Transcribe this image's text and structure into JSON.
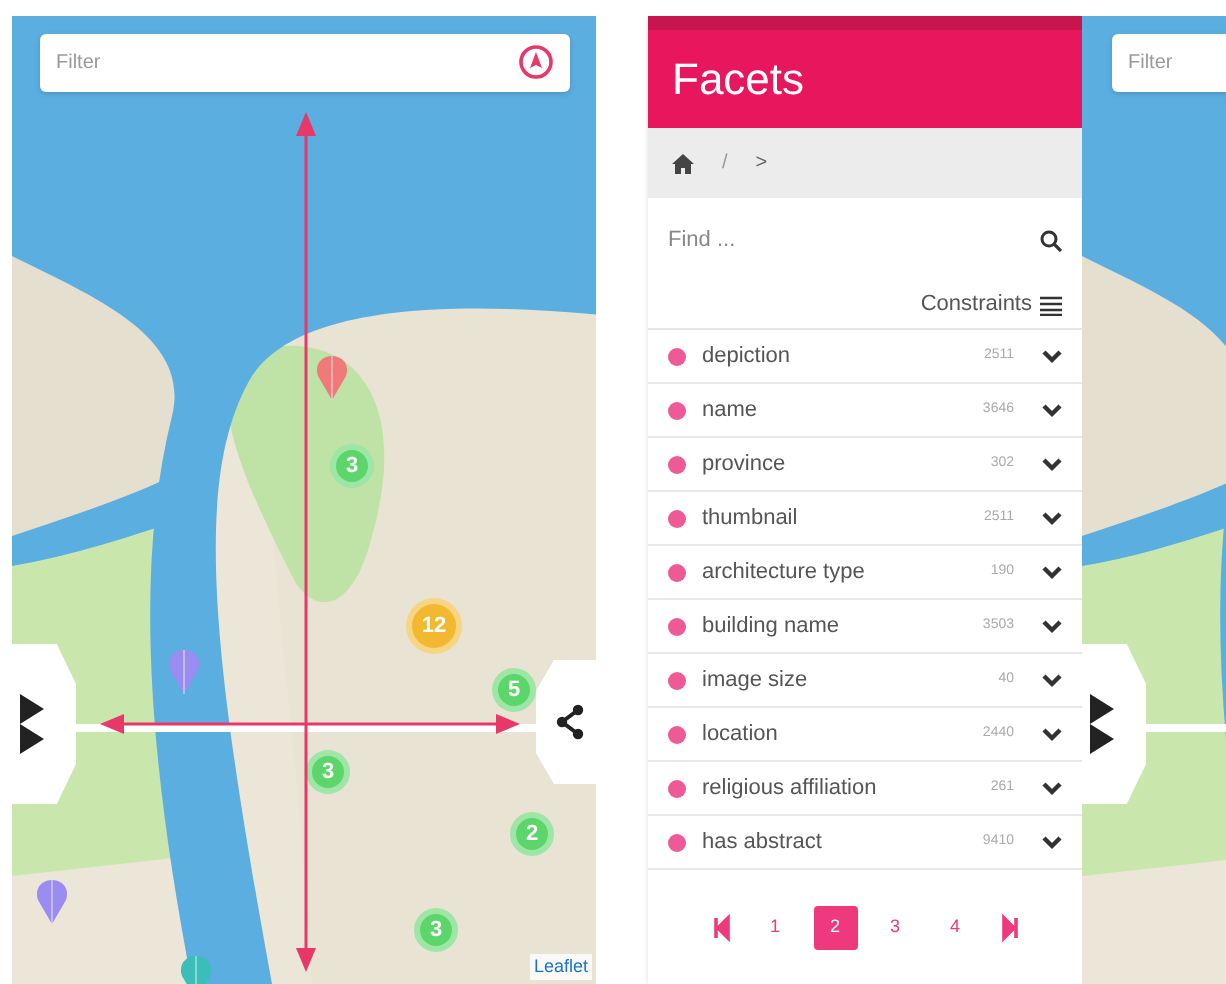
{
  "map_screen": {
    "filter": {
      "placeholder": "Filter"
    },
    "clusters": [
      {
        "count": "3",
        "color": "#5cd66a"
      },
      {
        "count": "12",
        "color": "#f2b930"
      },
      {
        "count": "5",
        "color": "#5cd66a"
      },
      {
        "count": "3",
        "color": "#5cd66a"
      },
      {
        "count": "2",
        "color": "#5cd66a"
      },
      {
        "count": "3",
        "color": "#5cd66a"
      }
    ],
    "attribution": "Leaflet"
  },
  "facets_panel": {
    "title": "Facets",
    "breadcrumb": {
      "separator": "/",
      "next": ">"
    },
    "search": {
      "placeholder": "Find ..."
    },
    "constraints_label": "Constraints",
    "facets": [
      {
        "name": "depiction",
        "count": "2511"
      },
      {
        "name": "name",
        "count": "3646"
      },
      {
        "name": "province",
        "count": "302"
      },
      {
        "name": "thumbnail",
        "count": "2511"
      },
      {
        "name": "architecture type",
        "count": "190"
      },
      {
        "name": "building name",
        "count": "3503"
      },
      {
        "name": "image size",
        "count": "40"
      },
      {
        "name": "location",
        "count": "2440"
      },
      {
        "name": "religious affiliation",
        "count": "261"
      },
      {
        "name": "has abstract",
        "count": "9410"
      }
    ],
    "pages": [
      {
        "label": "1",
        "selected": false
      },
      {
        "label": "2",
        "selected": true
      },
      {
        "label": "3",
        "selected": false
      },
      {
        "label": "4",
        "selected": false
      }
    ]
  },
  "second_map_screen": {
    "filter": {
      "placeholder": "Filter"
    }
  }
}
